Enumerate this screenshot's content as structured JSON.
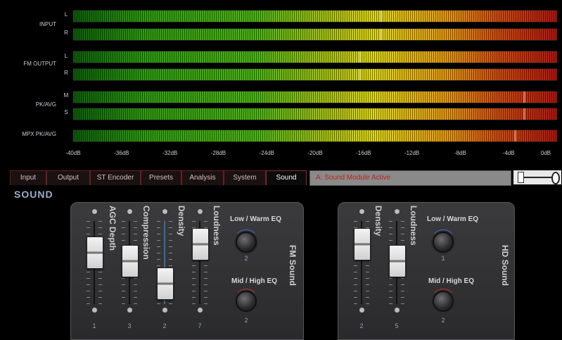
{
  "meters": {
    "groups": [
      {
        "name": "INPUT",
        "channels": [
          "L",
          "R"
        ]
      },
      {
        "name": "FM OUTPUT",
        "channels": [
          "L",
          "R"
        ]
      },
      {
        "name": "PK/AVG",
        "channels": [
          "M",
          "S"
        ]
      },
      {
        "name": "MPX PK/AVG",
        "channels": [
          ""
        ]
      }
    ],
    "scale": [
      "-40dB",
      "-36dB",
      "-32dB",
      "-28dB",
      "-24dB",
      "-20dB",
      "-16dB",
      "-12dB",
      "-8dB",
      "-4dB",
      "0dB"
    ]
  },
  "tabs": [
    "Input",
    "Output",
    "ST Encoder",
    "Presets",
    "Analysis",
    "System",
    "Sound"
  ],
  "active_tab": "Sound",
  "status_text": "A: Sound Module Active",
  "section_title": "SOUND",
  "fm_panel": {
    "name": "FM Sound",
    "faders": [
      {
        "name": "AGC Depth",
        "value": "1"
      },
      {
        "name": "Compression",
        "value": "3"
      },
      {
        "name": "Density",
        "value": "2"
      },
      {
        "name": "Loudness",
        "value": "7"
      }
    ],
    "knobs": [
      {
        "name": "Low / Warm EQ",
        "value": "2"
      },
      {
        "name": "Mid / High EQ",
        "value": "2"
      }
    ]
  },
  "hd_panel": {
    "name": "HD Sound",
    "faders": [
      {
        "name": "Density",
        "value": "2"
      },
      {
        "name": "Loudness",
        "value": "5"
      }
    ],
    "knobs": [
      {
        "name": "Low / Warm EQ",
        "value": "1"
      },
      {
        "name": "Mid / High EQ",
        "value": "2"
      }
    ]
  }
}
